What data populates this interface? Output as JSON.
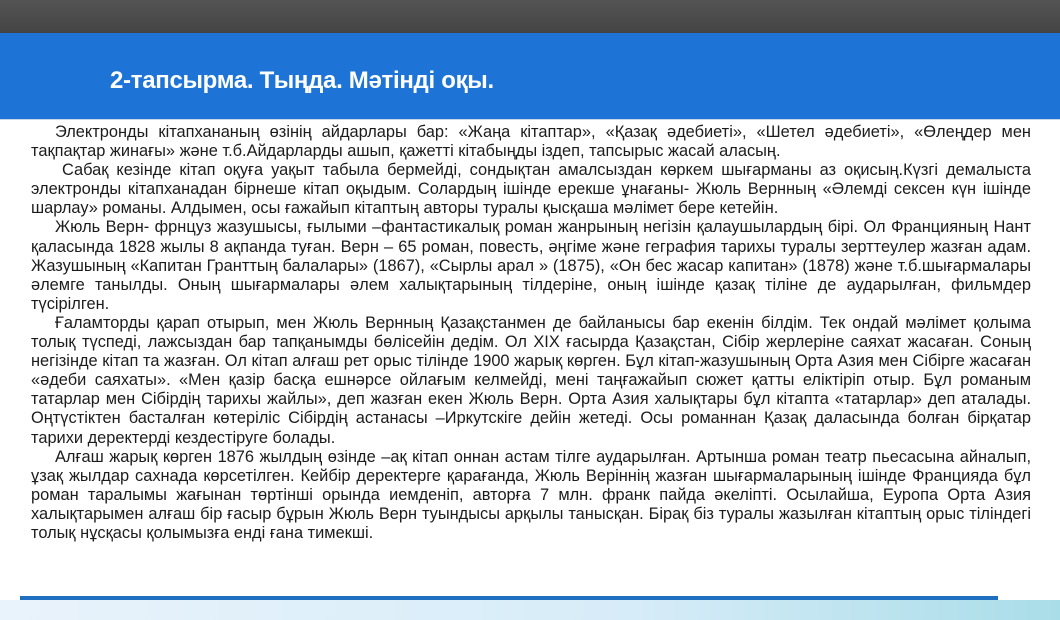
{
  "header": {
    "title": "2-тапсырма. Тыңда. Мәтінді оқы."
  },
  "paragraphs": [
    "Электронды кітапхананың өзінің айдарлары бар: «Жаңа кітаптар», «Қазақ әдебиеті», «Шетел әдебиеті», «Өлеңдер мен тақпақтар жинағы» және т.б.Айдарларды ашып, қажетті кітабыңды іздеп, тапсырыс жасай аласың.",
    "Сабақ кезінде кітап оқуға уақыт табыла бермейді, сондықтан амалсыздан көркем шығарманы аз оқисың.Күзгі демалыста электронды кітапханадан бірнеше кітап оқыдым. Солардың ішінде ерекше ұнағаны- Жюль Вернның «Әлемді сексен күн ішінде шарлау» романы. Алдымен, осы ғажайып кітаптың авторы туралы қысқаша мәлімет бере кетейін.",
    "Жюль Верн- фрнцуз жазушысы, ғылыми –фантастикалық роман жанрының негізін қалаушылардың бірі. Ол Францияның Нант қаласында 1828 жылы 8 ақпанда туған. Верн – 65 роман, повесть, әңгіме және геграфия тарихы туралы зерттеулер жазған адам. Жазушының «Капитан Гранттың балалары» (1867), «Сырлы арал » (1875), «Он бес жасар капитан» (1878) және т.б.шығармалары әлемге танылды. Оның шығармалары әлем халықтарының тілдеріне, оның ішінде қазақ тіліне де аударылған, фильмдер түсірілген.",
    "Ғаламторды қарап отырып, мен Жюль Вернның Қазақстанмен де байланысы бар екенін білдім. Тек ондай мәлімет қолыма толық түспеді, лажсыздан бар тапқанымды бөлісейін дедім. Ол XIX ғасырда Қазақстан, Сібір жерлеріне саяхат жасаған. Соның негізінде кітап та жазған. Ол кітап алғаш рет орыс тілінде 1900 жарық көрген. Бұл кітап-жазушының Орта Азия мен Сібірге жасаған «әдеби саяхаты». «Мен қазір басқа ешнәрсе ойлағым келмейді, мені таңғажайып сюжет қатты еліктіріп отыр. Бұл романым татарлар мен Сібірдің тарихы жайлы», деп жазған екен Жюль Верн. Орта Азия халықтары бұл кітапта «татарлар» деп аталады. Оңтүстіктен басталған көтеріліс Сібірдің астанасы –Иркутскіге дейін жетеді. Осы романнан Қазақ даласында болған бірқатар тарихи деректерді кездестіруге болады.",
    "Алғаш жарық көрген 1876 жылдың өзінде –ақ кітап оннан астам тілге аударылған. Артынша роман театр пьесасына айналып, ұзақ жылдар сахнада көрсетілген. Кейбір деректерге қарағанда, Жюль Веріннің жазған шығармаларының ішінде Францияда бұл роман таралымы жағынан төртінші орында иемденіп, авторға 7 млн. франк пайда әкеліпті. Осылайша, Еуропа Орта Азия халықтарымен алғаш бір ғасыр бұрын Жюль Верн туындысы арқылы танысқан. Бірақ біз туралы жазылған кітаптың орыс тіліндегі толық нұсқасы қолымызға енді ғана тимекші."
  ]
}
